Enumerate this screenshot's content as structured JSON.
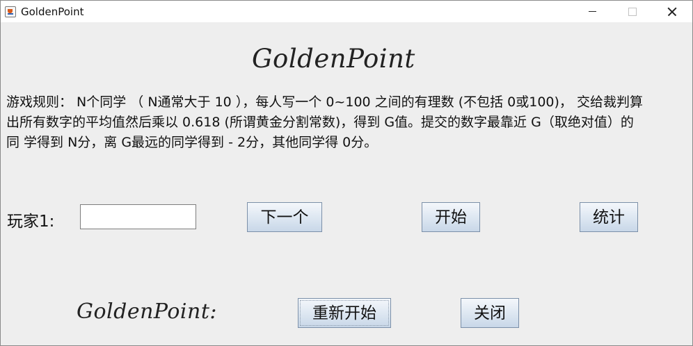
{
  "window": {
    "title": "GoldenPoint"
  },
  "header": {
    "brand": "GoldenPoint"
  },
  "rules": {
    "line1": "游戏规则：  N个同学 （ N通常大于 10 ），每人写一个 0~100 之间的有理数 (不包括 0或100)， 交给裁判算",
    "line2": "出所有数字的平均值然后乘以 0.618 (所谓黄金分割常数)，得到 G值。提交的数字最靠近 G（取绝对值）的",
    "line3": "同 学得到 N分，离 G最远的同学得到 -  2分，其他同学得 0分。"
  },
  "player": {
    "label": "玩家1:",
    "input_value": ""
  },
  "buttons": {
    "next": "下一个",
    "start": "开始",
    "stats": "统计",
    "restart": "重新开始",
    "close": "关闭"
  },
  "footer": {
    "brand": "GoldenPoint:"
  },
  "icons": {
    "app": "java-icon",
    "minimize": "minimize-icon",
    "maximize": "maximize-icon",
    "close": "close-icon"
  }
}
